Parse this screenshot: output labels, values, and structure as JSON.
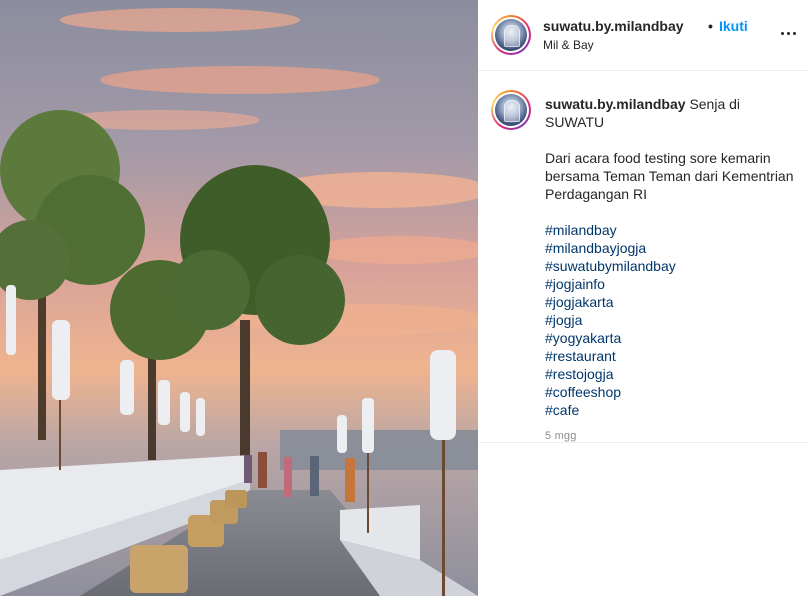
{
  "post": {
    "username": "suwatu.by.milandbay",
    "separator": "•",
    "follow_label": "Ikuti",
    "location": "Mil & Bay",
    "more_icon": "more-horizontal-icon"
  },
  "caption": {
    "username": "suwatu.by.milandbay",
    "title": "Senja di SUWATU",
    "body": "Dari acara food testing sore kemarin bersama Teman Teman dari Kementrian Perdagangan RI",
    "hashtags": [
      "#milandbay",
      "#milandbayjogja",
      "#suwatubymilandbay",
      "#jogjainfo",
      "#jogjakarta",
      "#jogja",
      "#yogyakarta",
      "#restaurant",
      "#restojogja",
      "#coffeeshop",
      "#cafe"
    ],
    "time_ago": "5 mgg"
  },
  "colors": {
    "link_blue": "#0095f6",
    "hashtag_blue": "#00376b",
    "text": "#262626",
    "muted": "#8e8e8e"
  }
}
